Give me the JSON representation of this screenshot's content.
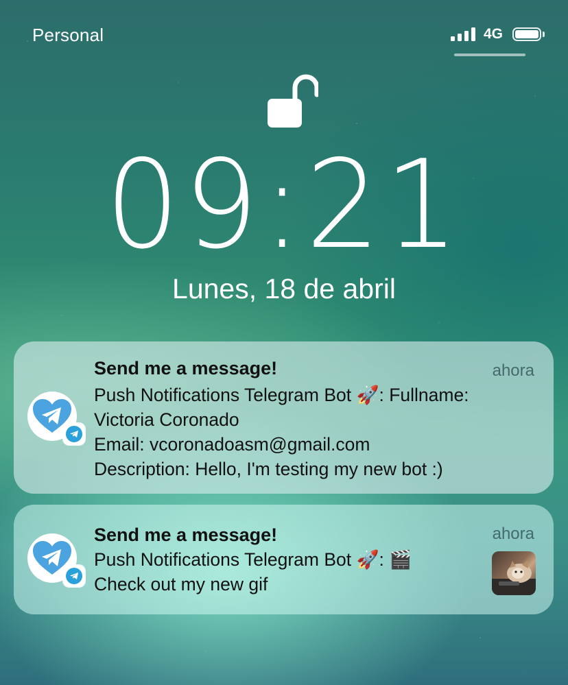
{
  "status_bar": {
    "carrier": "Personal",
    "network": "4G",
    "signal_bars": 4,
    "battery_level": 1.0
  },
  "lock_screen": {
    "time": "09:21",
    "date": "Lunes, 18 de abril",
    "lock_state": "unlocked"
  },
  "notifications": [
    {
      "app_icon": "telegram-heart-icon",
      "title": "Send me a message!",
      "time": "ahora",
      "body_lines": [
        "Push Notifications Telegram Bot 🚀: Fullname:",
        "Victoria Coronado",
        "Email: vcoronadoasm@gmail.com",
        "Description: Hello, I'm testing my new bot :)"
      ]
    },
    {
      "app_icon": "telegram-heart-icon",
      "title": "Send me a message!",
      "time": "ahora",
      "body_lines": [
        "Push Notifications Telegram Bot 🚀: 🎬",
        "Check out my new gif"
      ],
      "thumbnail": "cat-gif-thumbnail"
    }
  ],
  "colors": {
    "telegram_blue": "#2AA1DA",
    "card_background": "rgba(215,235,235,0.62)"
  }
}
